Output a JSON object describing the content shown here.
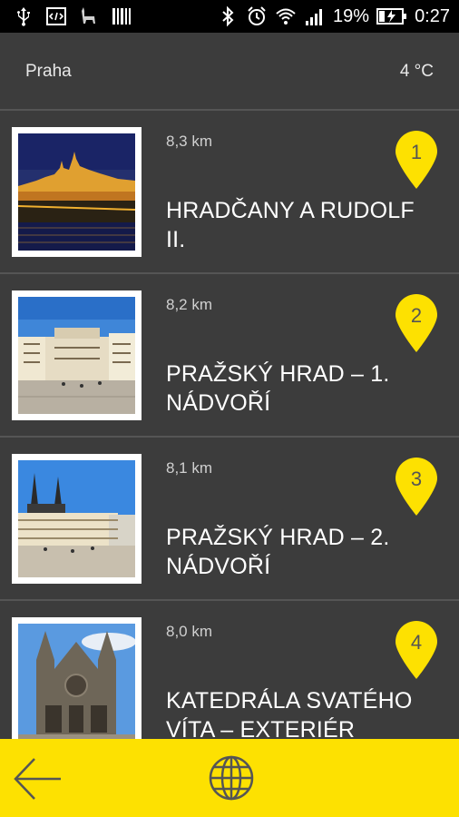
{
  "status_bar": {
    "battery_percent": "19%",
    "time": "0:27",
    "icons": [
      "usb-icon",
      "code-icon",
      "llama-icon",
      "barcode-icon",
      "bluetooth-icon",
      "alarm-icon",
      "wifi-icon",
      "signal-icon",
      "battery-charging-icon"
    ]
  },
  "header": {
    "city": "Praha",
    "temperature": "4 °C"
  },
  "places": [
    {
      "number": "1",
      "distance": "8,3 km",
      "title": "HRADČANY A RUDOLF II."
    },
    {
      "number": "2",
      "distance": "8,2 km",
      "title": "PRAŽSKÝ HRAD – 1. NÁDVOŘÍ"
    },
    {
      "number": "3",
      "distance": "8,1 km",
      "title": "PRAŽSKÝ HRAD – 2. NÁDVOŘÍ"
    },
    {
      "number": "4",
      "distance": "8,0 km",
      "title": "KATEDRÁLA SVATÉHO VÍTA – EXTERIÉR"
    }
  ],
  "bottom_bar": {
    "icons": [
      "back-arrow-icon",
      "globe-icon"
    ]
  },
  "colors": {
    "background": "#3c3c3c",
    "accent_yellow": "#fde101",
    "divider": "#555555"
  }
}
